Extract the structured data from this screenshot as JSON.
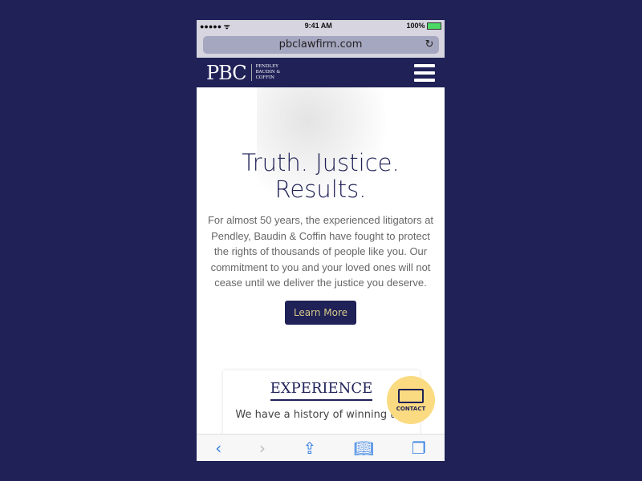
{
  "status": {
    "time": "9:41 AM",
    "battery": "100%",
    "signal": "●●●●● ᯤ"
  },
  "browser": {
    "url": "pbclawfirm.com"
  },
  "nav": {
    "logo_big": "PBC",
    "logo_small": [
      "PENDLEY",
      "BAUDIN &",
      "COFFIN"
    ]
  },
  "hero": {
    "title_line1": "Truth. Justice.",
    "title_line2": "Results.",
    "body": "For almost 50 years, the experienced litigators at Pendley, Baudin & Coffin have fought to protect the rights of thousands of people like you. Our commitment to you and your loved ones will not cease until we deliver the justice you deserve.",
    "button": "Learn More"
  },
  "card": {
    "title": "EXPERIENCE",
    "text": "We have a history of winning the"
  },
  "contact": {
    "label": "CONTACT"
  },
  "colors": {
    "brand": "#1f2157",
    "accent": "#fbdb82",
    "link": "#2f7de1"
  }
}
